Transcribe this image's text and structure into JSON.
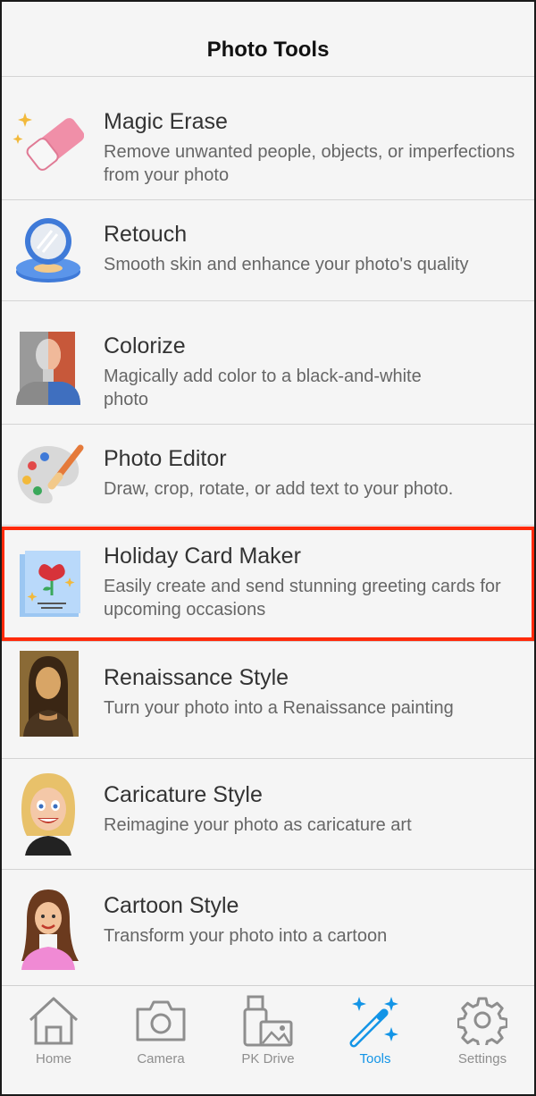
{
  "header": {
    "title": "Photo Tools"
  },
  "tools": [
    {
      "title": "Magic Erase",
      "description": "Remove unwanted people, objects, or imperfections from your photo",
      "icon": "eraser-icon"
    },
    {
      "title": "Retouch",
      "description": "Smooth skin and enhance your photo's quality",
      "icon": "compact-mirror-icon"
    },
    {
      "title": "Colorize",
      "description": "Magically add color to a black-and-white photo",
      "icon": "colorize-portrait-icon"
    },
    {
      "title": "Photo Editor",
      "description": "Draw, crop, rotate, or add text to your photo.",
      "icon": "palette-icon"
    },
    {
      "title": "Holiday Card Maker",
      "description": "Easily create and send stunning greeting cards for upcoming occasions",
      "icon": "greeting-card-icon",
      "highlighted": true
    },
    {
      "title": "Renaissance Style",
      "description": "Turn your photo into a Renaissance painting",
      "icon": "renaissance-portrait-icon"
    },
    {
      "title": "Caricature Style",
      "description": "Reimagine your photo as caricature art",
      "icon": "caricature-portrait-icon"
    },
    {
      "title": "Cartoon Style",
      "description": "Transform your photo into a cartoon",
      "icon": "cartoon-portrait-icon"
    }
  ],
  "tabbar": {
    "items": [
      {
        "label": "Home",
        "icon": "home-icon"
      },
      {
        "label": "Camera",
        "icon": "camera-icon"
      },
      {
        "label": "PK Drive",
        "icon": "drive-icon"
      },
      {
        "label": "Tools",
        "icon": "magic-wand-icon",
        "active": true
      },
      {
        "label": "Settings",
        "icon": "gear-icon"
      }
    ]
  },
  "colors": {
    "accent": "#1294e6",
    "highlight_border": "#ff2a0a",
    "inactive_tab": "#8e8e8e"
  }
}
